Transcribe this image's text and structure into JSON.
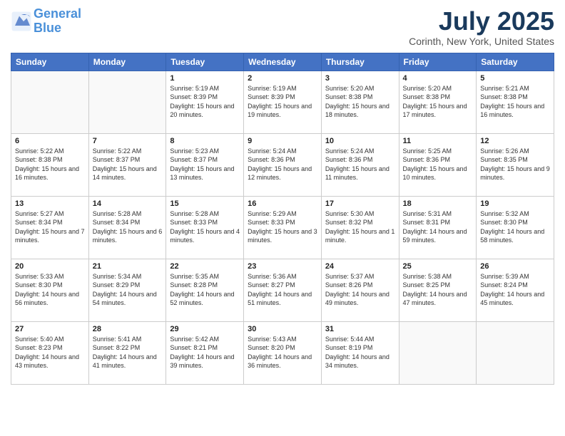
{
  "header": {
    "logo_line1": "General",
    "logo_line2": "Blue",
    "month_title": "July 2025",
    "location": "Corinth, New York, United States"
  },
  "weekdays": [
    "Sunday",
    "Monday",
    "Tuesday",
    "Wednesday",
    "Thursday",
    "Friday",
    "Saturday"
  ],
  "weeks": [
    [
      {
        "num": "",
        "sunrise": "",
        "sunset": "",
        "daylight": ""
      },
      {
        "num": "",
        "sunrise": "",
        "sunset": "",
        "daylight": ""
      },
      {
        "num": "1",
        "sunrise": "Sunrise: 5:19 AM",
        "sunset": "Sunset: 8:39 PM",
        "daylight": "Daylight: 15 hours and 20 minutes."
      },
      {
        "num": "2",
        "sunrise": "Sunrise: 5:19 AM",
        "sunset": "Sunset: 8:39 PM",
        "daylight": "Daylight: 15 hours and 19 minutes."
      },
      {
        "num": "3",
        "sunrise": "Sunrise: 5:20 AM",
        "sunset": "Sunset: 8:38 PM",
        "daylight": "Daylight: 15 hours and 18 minutes."
      },
      {
        "num": "4",
        "sunrise": "Sunrise: 5:20 AM",
        "sunset": "Sunset: 8:38 PM",
        "daylight": "Daylight: 15 hours and 17 minutes."
      },
      {
        "num": "5",
        "sunrise": "Sunrise: 5:21 AM",
        "sunset": "Sunset: 8:38 PM",
        "daylight": "Daylight: 15 hours and 16 minutes."
      }
    ],
    [
      {
        "num": "6",
        "sunrise": "Sunrise: 5:22 AM",
        "sunset": "Sunset: 8:38 PM",
        "daylight": "Daylight: 15 hours and 16 minutes."
      },
      {
        "num": "7",
        "sunrise": "Sunrise: 5:22 AM",
        "sunset": "Sunset: 8:37 PM",
        "daylight": "Daylight: 15 hours and 14 minutes."
      },
      {
        "num": "8",
        "sunrise": "Sunrise: 5:23 AM",
        "sunset": "Sunset: 8:37 PM",
        "daylight": "Daylight: 15 hours and 13 minutes."
      },
      {
        "num": "9",
        "sunrise": "Sunrise: 5:24 AM",
        "sunset": "Sunset: 8:36 PM",
        "daylight": "Daylight: 15 hours and 12 minutes."
      },
      {
        "num": "10",
        "sunrise": "Sunrise: 5:24 AM",
        "sunset": "Sunset: 8:36 PM",
        "daylight": "Daylight: 15 hours and 11 minutes."
      },
      {
        "num": "11",
        "sunrise": "Sunrise: 5:25 AM",
        "sunset": "Sunset: 8:36 PM",
        "daylight": "Daylight: 15 hours and 10 minutes."
      },
      {
        "num": "12",
        "sunrise": "Sunrise: 5:26 AM",
        "sunset": "Sunset: 8:35 PM",
        "daylight": "Daylight: 15 hours and 9 minutes."
      }
    ],
    [
      {
        "num": "13",
        "sunrise": "Sunrise: 5:27 AM",
        "sunset": "Sunset: 8:34 PM",
        "daylight": "Daylight: 15 hours and 7 minutes."
      },
      {
        "num": "14",
        "sunrise": "Sunrise: 5:28 AM",
        "sunset": "Sunset: 8:34 PM",
        "daylight": "Daylight: 15 hours and 6 minutes."
      },
      {
        "num": "15",
        "sunrise": "Sunrise: 5:28 AM",
        "sunset": "Sunset: 8:33 PM",
        "daylight": "Daylight: 15 hours and 4 minutes."
      },
      {
        "num": "16",
        "sunrise": "Sunrise: 5:29 AM",
        "sunset": "Sunset: 8:33 PM",
        "daylight": "Daylight: 15 hours and 3 minutes."
      },
      {
        "num": "17",
        "sunrise": "Sunrise: 5:30 AM",
        "sunset": "Sunset: 8:32 PM",
        "daylight": "Daylight: 15 hours and 1 minute."
      },
      {
        "num": "18",
        "sunrise": "Sunrise: 5:31 AM",
        "sunset": "Sunset: 8:31 PM",
        "daylight": "Daylight: 14 hours and 59 minutes."
      },
      {
        "num": "19",
        "sunrise": "Sunrise: 5:32 AM",
        "sunset": "Sunset: 8:30 PM",
        "daylight": "Daylight: 14 hours and 58 minutes."
      }
    ],
    [
      {
        "num": "20",
        "sunrise": "Sunrise: 5:33 AM",
        "sunset": "Sunset: 8:30 PM",
        "daylight": "Daylight: 14 hours and 56 minutes."
      },
      {
        "num": "21",
        "sunrise": "Sunrise: 5:34 AM",
        "sunset": "Sunset: 8:29 PM",
        "daylight": "Daylight: 14 hours and 54 minutes."
      },
      {
        "num": "22",
        "sunrise": "Sunrise: 5:35 AM",
        "sunset": "Sunset: 8:28 PM",
        "daylight": "Daylight: 14 hours and 52 minutes."
      },
      {
        "num": "23",
        "sunrise": "Sunrise: 5:36 AM",
        "sunset": "Sunset: 8:27 PM",
        "daylight": "Daylight: 14 hours and 51 minutes."
      },
      {
        "num": "24",
        "sunrise": "Sunrise: 5:37 AM",
        "sunset": "Sunset: 8:26 PM",
        "daylight": "Daylight: 14 hours and 49 minutes."
      },
      {
        "num": "25",
        "sunrise": "Sunrise: 5:38 AM",
        "sunset": "Sunset: 8:25 PM",
        "daylight": "Daylight: 14 hours and 47 minutes."
      },
      {
        "num": "26",
        "sunrise": "Sunrise: 5:39 AM",
        "sunset": "Sunset: 8:24 PM",
        "daylight": "Daylight: 14 hours and 45 minutes."
      }
    ],
    [
      {
        "num": "27",
        "sunrise": "Sunrise: 5:40 AM",
        "sunset": "Sunset: 8:23 PM",
        "daylight": "Daylight: 14 hours and 43 minutes."
      },
      {
        "num": "28",
        "sunrise": "Sunrise: 5:41 AM",
        "sunset": "Sunset: 8:22 PM",
        "daylight": "Daylight: 14 hours and 41 minutes."
      },
      {
        "num": "29",
        "sunrise": "Sunrise: 5:42 AM",
        "sunset": "Sunset: 8:21 PM",
        "daylight": "Daylight: 14 hours and 39 minutes."
      },
      {
        "num": "30",
        "sunrise": "Sunrise: 5:43 AM",
        "sunset": "Sunset: 8:20 PM",
        "daylight": "Daylight: 14 hours and 36 minutes."
      },
      {
        "num": "31",
        "sunrise": "Sunrise: 5:44 AM",
        "sunset": "Sunset: 8:19 PM",
        "daylight": "Daylight: 14 hours and 34 minutes."
      },
      {
        "num": "",
        "sunrise": "",
        "sunset": "",
        "daylight": ""
      },
      {
        "num": "",
        "sunrise": "",
        "sunset": "",
        "daylight": ""
      }
    ]
  ]
}
